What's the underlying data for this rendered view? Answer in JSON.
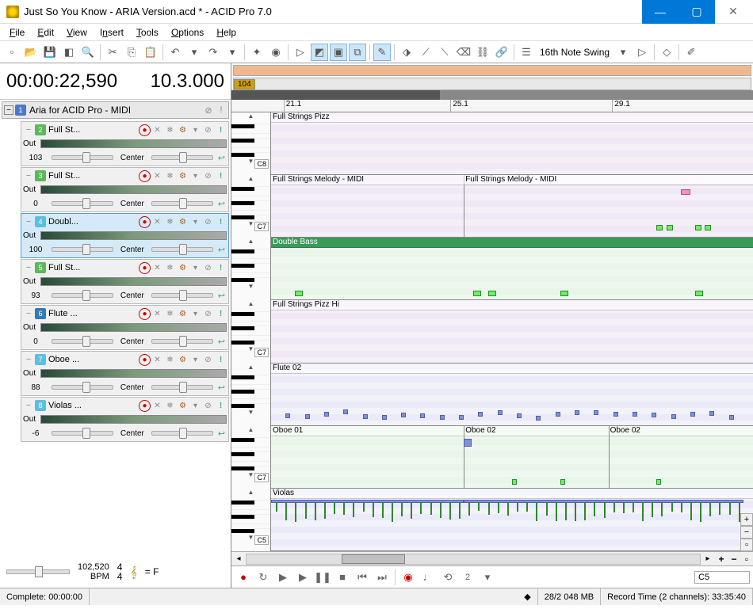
{
  "window": {
    "title": "Just So You Know - ARIA Version.acd * - ACID Pro 7.0"
  },
  "menu": [
    "File",
    "Edit",
    "View",
    "Insert",
    "Tools",
    "Options",
    "Help"
  ],
  "toolbar_swing": "16th Note Swing",
  "timecode": {
    "time": "00:00:22,590",
    "bars": "10.3.000"
  },
  "bus": {
    "name": "Aria for ACID Pro - MIDI"
  },
  "tracks": [
    {
      "num": "2",
      "color": "c2",
      "name": "Full St...",
      "vol": "103",
      "pan": "Center",
      "sel": false
    },
    {
      "num": "3",
      "color": "c3",
      "name": "Full St...",
      "vol": "0",
      "pan": "Center",
      "sel": false
    },
    {
      "num": "4",
      "color": "c4",
      "name": "Doubl...",
      "vol": "100",
      "pan": "Center",
      "sel": true
    },
    {
      "num": "5",
      "color": "c5",
      "name": "Full St...",
      "vol": "93",
      "pan": "Center",
      "sel": false
    },
    {
      "num": "6",
      "color": "c6",
      "name": "Flute ...",
      "vol": "0",
      "pan": "Center",
      "sel": false
    },
    {
      "num": "7",
      "color": "c7",
      "name": "Oboe ...",
      "vol": "88",
      "pan": "Center",
      "sel": false
    },
    {
      "num": "8",
      "color": "c8",
      "name": "Violas ...",
      "vol": "-6",
      "pan": "Center",
      "sel": false
    }
  ],
  "lanes": [
    {
      "name": "Full Strings Pizz",
      "cls": "purple",
      "rollLabel": "C8"
    },
    {
      "name": "Full Strings Melody - MIDI",
      "cls": "purple",
      "rollLabel": "C7"
    },
    {
      "name": "Double Bass",
      "cls": "green selected",
      "rollLabel": ""
    },
    {
      "name": "Full Strings Pizz Hi",
      "cls": "purple",
      "rollLabel": "C7"
    },
    {
      "name": "Flute 02",
      "cls": "blue",
      "rollLabel": ""
    },
    {
      "name": "Oboe 01",
      "extra": [
        "Oboe 02",
        "Oboe 02"
      ],
      "cls": "green",
      "rollLabel": "C7"
    },
    {
      "name": "Violas",
      "cls": "blue",
      "rollLabel": "C5"
    }
  ],
  "ruler": [
    {
      "pos": 10,
      "label": "21.1"
    },
    {
      "pos": 42,
      "label": "25.1"
    },
    {
      "pos": 73,
      "label": "29.1"
    }
  ],
  "marker": "104",
  "tempo": {
    "bpm_value": "102,520",
    "bpm_label": "BPM",
    "sig_num": "4",
    "sig_den": "4",
    "key": "= F"
  },
  "transport_pitch": "C5",
  "status": {
    "complete": "Complete: 00:00:00",
    "mem": "28/2 048 MB",
    "rectime": "Record Time (2 channels): 33:35:40"
  },
  "labels": {
    "out": "Out"
  }
}
